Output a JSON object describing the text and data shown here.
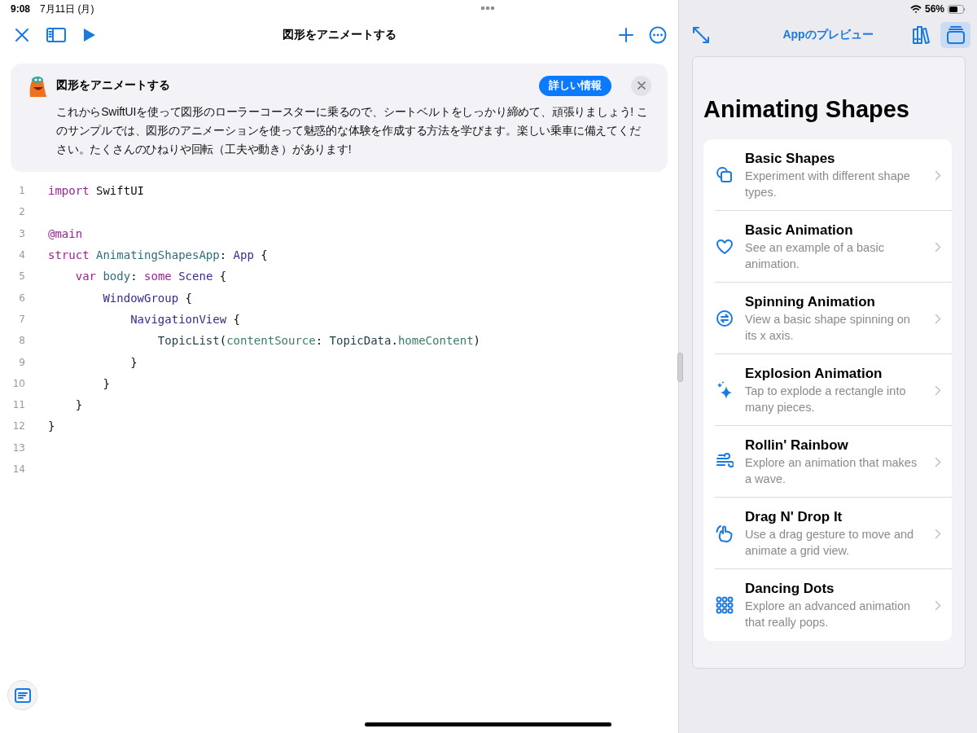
{
  "status_bar": {
    "time": "9:08",
    "date": "7月11日 (月)",
    "battery": "56%"
  },
  "editor": {
    "title": "図形をアニメートする"
  },
  "banner": {
    "title": "図形をアニメートする",
    "button": "詳しい情報",
    "text": "これからSwiftUIを使って図形のローラーコースターに乗るので、シートベルトをしっかり締めて、頑張りましょう! このサンプルでは、図形のアニメーションを使って魅惑的な体験を作成する方法を学びます。楽しい乗車に備えてください。たくさんのひねりや回転（工夫や動き）があります!"
  },
  "code": [
    {
      "number": "1",
      "tokens": [
        {
          "text": "import",
          "kind": "keyword"
        },
        {
          "text": " SwiftUI",
          "kind": "plain"
        }
      ]
    },
    {
      "number": "2"
    },
    {
      "number": "3",
      "tokens": [
        {
          "text": "@main",
          "kind": "keyword"
        }
      ]
    },
    {
      "number": "4",
      "tokens": [
        {
          "text": "struct",
          "kind": "keyword"
        },
        {
          "text": " AnimatingShapesApp",
          "kind": "decl"
        },
        {
          "text": ": ",
          "kind": "plain"
        },
        {
          "text": "App",
          "kind": "type"
        },
        {
          "text": " {",
          "kind": "plain"
        }
      ]
    },
    {
      "number": "5",
      "tokens": [
        {
          "text": "    var",
          "kind": "keyword"
        },
        {
          "text": " body",
          "kind": "decl"
        },
        {
          "text": ": ",
          "kind": "plain"
        },
        {
          "text": "some",
          "kind": "keyword"
        },
        {
          "text": " Scene",
          "kind": "type"
        },
        {
          "text": " {",
          "kind": "plain"
        }
      ]
    },
    {
      "number": "6",
      "tokens": [
        {
          "text": "        WindowGroup",
          "kind": "type"
        },
        {
          "text": " {",
          "kind": "plain"
        }
      ]
    },
    {
      "number": "7",
      "tokens": [
        {
          "text": "            NavigationView",
          "kind": "type"
        },
        {
          "text": " {",
          "kind": "plain"
        }
      ]
    },
    {
      "number": "8",
      "tokens": [
        {
          "text": "                TopicList",
          "kind": "project"
        },
        {
          "text": "(",
          "kind": "plain"
        },
        {
          "text": "contentSource",
          "kind": "member"
        },
        {
          "text": ": ",
          "kind": "plain"
        },
        {
          "text": "TopicData",
          "kind": "project"
        },
        {
          "text": ".",
          "kind": "plain"
        },
        {
          "text": "homeContent",
          "kind": "member"
        },
        {
          "text": ")",
          "kind": "plain"
        }
      ]
    },
    {
      "number": "9",
      "tokens": [
        {
          "text": "            }",
          "kind": "plain"
        }
      ]
    },
    {
      "number": "10",
      "tokens": [
        {
          "text": "        }",
          "kind": "plain"
        }
      ]
    },
    {
      "number": "11",
      "tokens": [
        {
          "text": "    }",
          "kind": "plain"
        }
      ]
    },
    {
      "number": "12",
      "tokens": [
        {
          "text": "}",
          "kind": "plain"
        }
      ]
    },
    {
      "number": "13"
    },
    {
      "number": "14"
    }
  ],
  "preview": {
    "title": "Appのプレビュー",
    "view_buttons": [
      {
        "selected": false
      },
      {
        "selected": true
      }
    ],
    "heading": "Animating Shapes",
    "topics": [
      {
        "title": "Basic Shapes",
        "description": "Experiment with different shape types."
      },
      {
        "title": "Basic Animation",
        "description": "See an example of a basic animation."
      },
      {
        "title": "Spinning Animation",
        "description": "View a basic shape spinning on its x axis."
      },
      {
        "title": "Explosion Animation",
        "description": "Tap to explode a rectangle into many pieces."
      },
      {
        "title": "Rollin' Rainbow",
        "description": "Explore an animation that makes a wave."
      },
      {
        "title": "Drag N' Drop It",
        "description": "Use a drag gesture to move and animate a grid view."
      },
      {
        "title": "Dancing Dots",
        "description": "Explore an advanced animation that really pops."
      }
    ]
  }
}
